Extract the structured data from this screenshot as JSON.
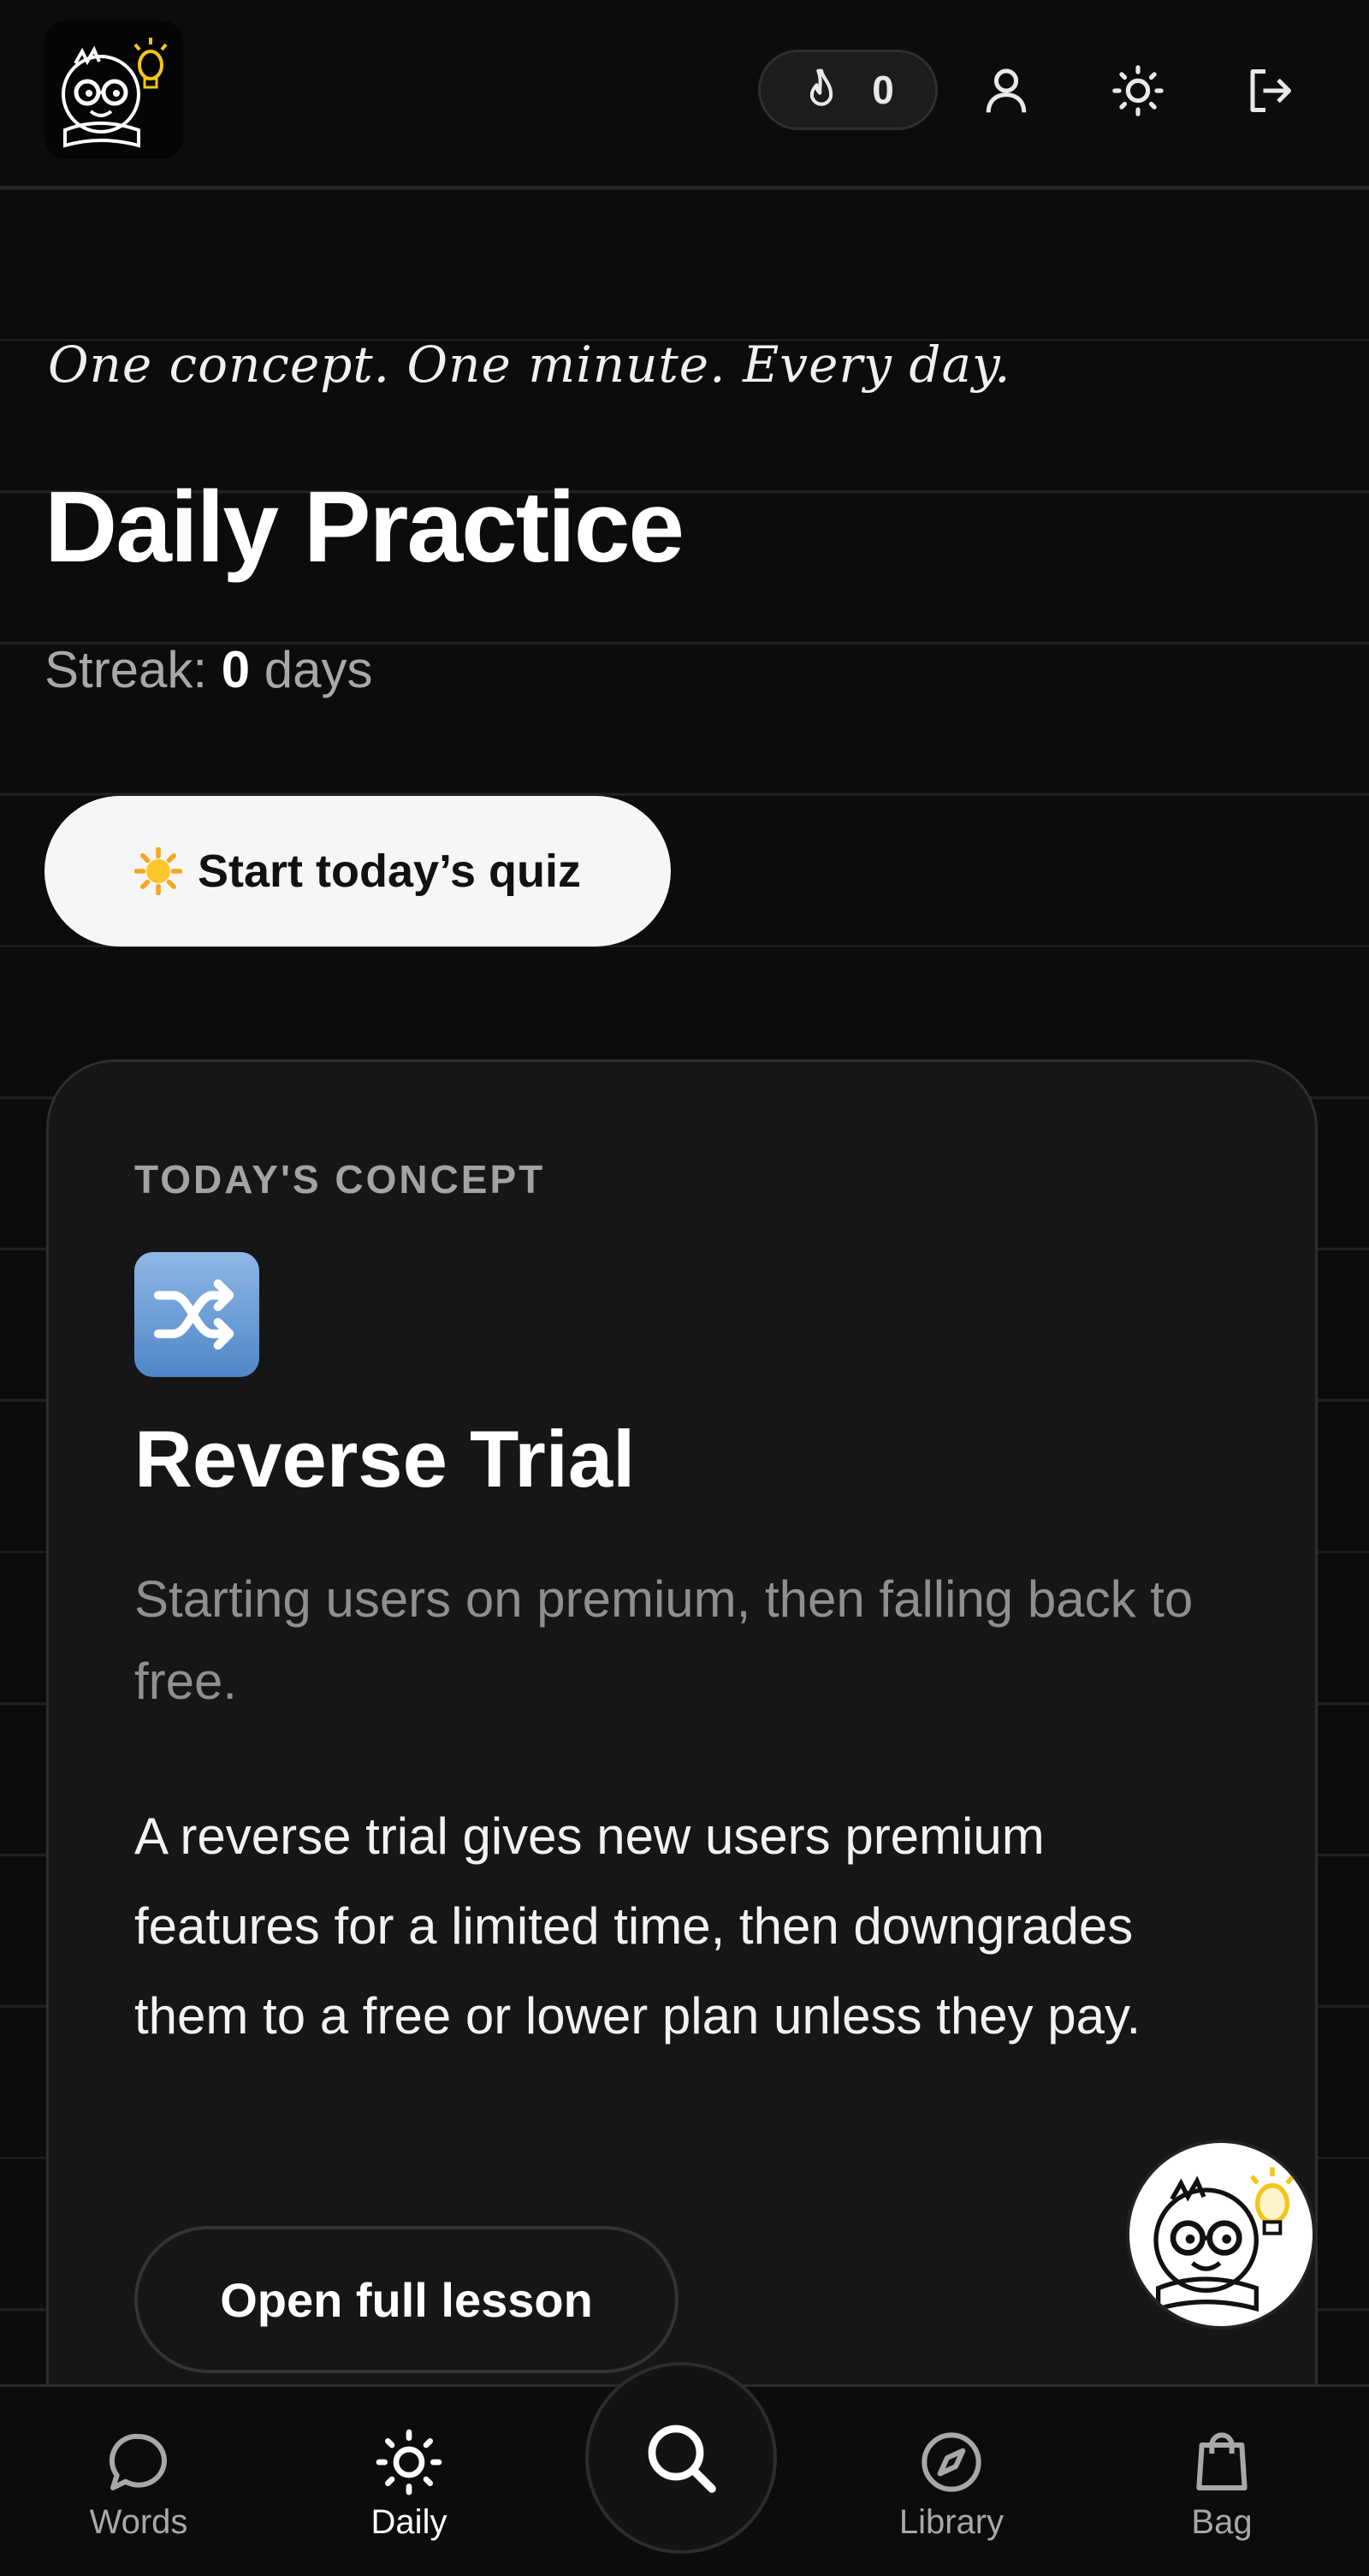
{
  "header": {
    "streak_count": "0",
    "icons": [
      "flame-icon",
      "user-icon",
      "sun-icon",
      "logout-icon"
    ]
  },
  "hero": {
    "tagline": "One concept. One minute. Every day.",
    "title": "Daily Practice",
    "streak_prefix": "Streak:",
    "streak_value": "0",
    "streak_suffix": "days",
    "quiz_button": "Start today’s quiz"
  },
  "concept": {
    "kicker": "TODAY'S CONCEPT",
    "emoji": "shuffle-icon",
    "title": "Reverse Trial",
    "subtitle": "Starting users on premium, then falling back to free.",
    "body": "A reverse trial gives new users premium features for a limited time, then downgrades them to a free or lower plan unless they pay.",
    "lesson_button": "Open full lesson"
  },
  "nav": {
    "items": [
      {
        "label": "Words",
        "icon": "chat-bubble-icon"
      },
      {
        "label": "Daily",
        "icon": "sun-icon",
        "active": true
      },
      {
        "label": "Library",
        "icon": "compass-icon"
      },
      {
        "label": "Bag",
        "icon": "shopping-bag-icon"
      }
    ],
    "center_icon": "search-icon"
  },
  "colors": {
    "background": "#0c0c0c",
    "card": "#161616",
    "accent_yellow": "#f5c518",
    "text_primary": "#ffffff",
    "text_muted": "#a8a8a8"
  }
}
